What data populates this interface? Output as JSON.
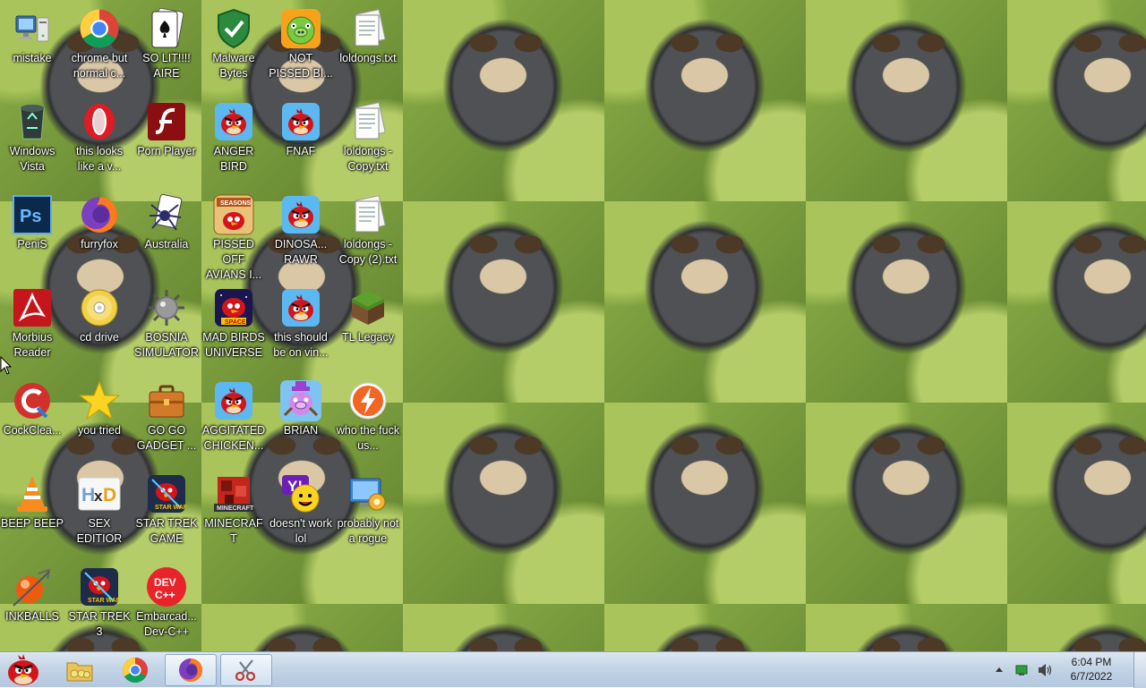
{
  "desktop": {
    "icons": [
      {
        "label": "mistake",
        "icon": "computer-icon"
      },
      {
        "label": "chrome but normal c...",
        "icon": "chrome-icon"
      },
      {
        "label": "SO LIT!!!! AIRE",
        "icon": "solitaire-icon"
      },
      {
        "label": "Malware Bytes",
        "icon": "shield-icon"
      },
      {
        "label": "NOT PISSED BI...",
        "icon": "pig-icon"
      },
      {
        "label": "loldongs.txt",
        "icon": "text-file-icon"
      },
      {
        "label": "Windows Vista",
        "icon": "recycle-bin-icon"
      },
      {
        "label": "this looks like a v...",
        "icon": "opera-icon"
      },
      {
        "label": "Porn Player",
        "icon": "flash-icon"
      },
      {
        "label": "ANGER BIRD",
        "icon": "angry-bird-icon"
      },
      {
        "label": "FNAF",
        "icon": "angry-bird-icon"
      },
      {
        "label": "loldongs - Copy.txt",
        "icon": "text-file-icon"
      },
      {
        "label": "PeniS",
        "icon": "photoshop-icon"
      },
      {
        "label": "furryfox",
        "icon": "firefox-icon"
      },
      {
        "label": "Australia",
        "icon": "spider-solitaire-icon"
      },
      {
        "label": "PISSED OFF AVIANS I...",
        "icon": "angry-birds-seasons-icon"
      },
      {
        "label": "DINOSA... RAWR",
        "icon": "angry-bird-icon"
      },
      {
        "label": "loldongs - Copy (2).txt",
        "icon": "text-file-icon"
      },
      {
        "label": "Morbius Reader",
        "icon": "pdf-reader-icon"
      },
      {
        "label": "cd drive",
        "icon": "cd-icon"
      },
      {
        "label": "BOSNIA SIMULATOR",
        "icon": "minesweeper-icon"
      },
      {
        "label": "MAD BIRDS UNIVERSE",
        "icon": "angry-birds-space-icon"
      },
      {
        "label": "this should be on vin...",
        "icon": "angry-bird-icon"
      },
      {
        "label": "TL Legacy",
        "icon": "grass-block-icon"
      },
      {
        "label": "CockClea...",
        "icon": "ccleaner-icon"
      },
      {
        "label": "you tried",
        "icon": "star-icon"
      },
      {
        "label": "GO GO GADGET ...",
        "icon": "briefcase-icon"
      },
      {
        "label": "AGGITATED CHICKEN...",
        "icon": "angry-bird-icon"
      },
      {
        "label": "BRIAN",
        "icon": "bad-piggies-icon"
      },
      {
        "label": "who the fuck us...",
        "icon": "bolt-icon"
      },
      {
        "label": "BEEP BEEP",
        "icon": "vlc-icon"
      },
      {
        "label": "SEX EDITIOR",
        "icon": "hxd-icon"
      },
      {
        "label": "STAR TREK GAME",
        "icon": "angry-birds-star-wars-icon"
      },
      {
        "label": "MINECRAFT",
        "icon": "minecraft-icon"
      },
      {
        "label": "doesn't work lol",
        "icon": "yahoo-icon"
      },
      {
        "label": "probably not a rogue",
        "icon": "control-panel-icon"
      },
      {
        "label": "INKBALLS",
        "icon": "inkball-icon"
      },
      {
        "label": "STAR TREK 3",
        "icon": "angry-birds-star-wars-icon"
      },
      {
        "label": "Embarcad... Dev-C++",
        "icon": "devcpp-icon"
      }
    ]
  },
  "taskbar": {
    "pinned": [
      {
        "name": "start-button",
        "icon": "angry-bird-icon"
      },
      {
        "name": "explorer",
        "icon": "folder-icon"
      },
      {
        "name": "chrome",
        "icon": "chrome-icon"
      },
      {
        "name": "firefox",
        "icon": "firefox-icon"
      },
      {
        "name": "snipping-tool",
        "icon": "scissors-icon"
      }
    ],
    "time": "6:04 PM",
    "date": "6/7/2022"
  }
}
